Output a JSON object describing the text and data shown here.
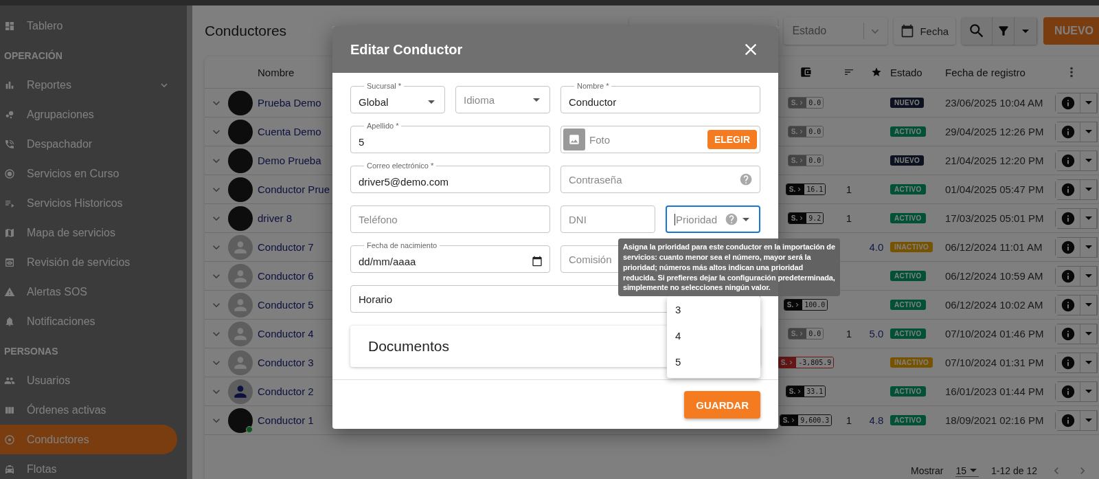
{
  "sidebar": {
    "items": [
      {
        "kind": "item",
        "label": "Tablero",
        "selected": false,
        "has_submenu": false
      },
      {
        "kind": "section",
        "label": "OPERACIÓN"
      },
      {
        "kind": "item",
        "label": "Reportes",
        "selected": false,
        "has_submenu": true
      },
      {
        "kind": "item",
        "label": "Agrupaciones",
        "selected": false,
        "has_submenu": false
      },
      {
        "kind": "item",
        "label": "Despachador",
        "selected": false,
        "has_submenu": false
      },
      {
        "kind": "item",
        "label": "Servicios en Curso",
        "selected": false,
        "has_submenu": false
      },
      {
        "kind": "item",
        "label": "Servicios Historicos",
        "selected": false,
        "has_submenu": false
      },
      {
        "kind": "item",
        "label": "Mapa de servicios",
        "selected": false,
        "has_submenu": false
      },
      {
        "kind": "item",
        "label": "Revisión de servicios",
        "selected": false,
        "has_submenu": false
      },
      {
        "kind": "item",
        "label": "Alertas SOS",
        "selected": false,
        "has_submenu": false
      },
      {
        "kind": "item",
        "label": "Notificaciones",
        "selected": false,
        "has_submenu": false
      },
      {
        "kind": "section",
        "label": "PERSONAS"
      },
      {
        "kind": "item",
        "label": "Usuarios",
        "selected": false,
        "has_submenu": false
      },
      {
        "kind": "item",
        "label": "Órdenes activas",
        "selected": false,
        "has_submenu": false
      },
      {
        "kind": "item",
        "label": "Conductores",
        "selected": true,
        "has_submenu": false
      },
      {
        "kind": "item",
        "label": "Flotas",
        "selected": false,
        "has_submenu": false
      }
    ]
  },
  "page": {
    "title": "Conductores",
    "status_filter": {
      "placeholder": "Estado"
    },
    "date_button": "Fecha",
    "new_button": "NUEVO"
  },
  "table": {
    "columns": [
      "Nombre",
      "Estado",
      "Fecha de registro"
    ],
    "rows": [
      {
        "name": "Prueba Demo",
        "avatar": {
          "kind": "photo"
        },
        "online": false,
        "wallet": {
          "kind": "zero",
          "prefix": "S.",
          "amount": "0.0"
        },
        "status": {
          "kind": "new",
          "label": "NUEVO"
        },
        "date": "23/06/2025 10:04 AM"
      },
      {
        "name": "Cuenta Demo",
        "avatar": {
          "kind": "photo"
        },
        "online": false,
        "wallet": {
          "kind": "zero",
          "prefix": "S.",
          "amount": "0.0"
        },
        "status": {
          "kind": "active",
          "label": "ACTIVO"
        },
        "date": "29/04/2025 12:26 PM"
      },
      {
        "name": "Demo Prueba",
        "avatar": {
          "kind": "photo"
        },
        "online": false,
        "wallet": {
          "kind": "zero",
          "prefix": "S.",
          "amount": "0.0"
        },
        "status": {
          "kind": "new",
          "label": "NUEVO"
        },
        "date": "21/04/2025 12:20 PM"
      },
      {
        "name": "Conductor Prue",
        "avatar": {
          "kind": "photo"
        },
        "online": false,
        "wallet": {
          "kind": "positive",
          "prefix": "S.",
          "amount": "16.1"
        },
        "count": "1",
        "status": {
          "kind": "active",
          "label": "ACTIVO"
        },
        "date": "01/04/2025 05:47 PM"
      },
      {
        "name": "driver 8",
        "avatar": {
          "kind": "photo"
        },
        "online": false,
        "wallet": {
          "kind": "positive",
          "prefix": "S.",
          "amount": "9.2"
        },
        "count": "1",
        "status": {
          "kind": "active",
          "label": "ACTIVO"
        },
        "date": "17/03/2025 05:01 PM"
      },
      {
        "name": "Conductor 7",
        "avatar": {
          "kind": "placeholder"
        },
        "online": false,
        "rating": "4.0",
        "status": {
          "kind": "inactive",
          "label": "INACTIVO"
        },
        "date": "06/12/2024 11:01 AM"
      },
      {
        "name": "Conductor 6",
        "avatar": {
          "kind": "placeholder"
        },
        "online": false,
        "status": {
          "kind": "active",
          "label": "ACTIVO"
        },
        "date": "06/12/2024 10:59 AM"
      },
      {
        "name": "Conductor 5",
        "avatar": {
          "kind": "placeholder"
        },
        "online": false,
        "wallet": {
          "kind": "positive",
          "prefix": "S.",
          "amount": "100.0"
        },
        "status": {
          "kind": "active",
          "label": "ACTIVO"
        },
        "date": "06/12/2024 10:02 AM"
      },
      {
        "name": "Conductor 4",
        "avatar": {
          "kind": "placeholder"
        },
        "online": false,
        "wallet": {
          "kind": "zero",
          "prefix": "S.",
          "amount": "0.0"
        },
        "count": "1",
        "rating": "5.0",
        "status": {
          "kind": "active",
          "label": "ACTIVO"
        },
        "date": "07/10/2024 01:46 PM"
      },
      {
        "name": "Conductor 3",
        "avatar": {
          "kind": "placeholder"
        },
        "online": false,
        "wallet": {
          "kind": "negative",
          "prefix": "S.",
          "amount": "-3,805.9"
        },
        "status": {
          "kind": "inactive",
          "label": "INACTIVO"
        },
        "date": "07/10/2024 01:31 PM"
      },
      {
        "name": "Conductor 2",
        "avatar": {
          "kind": "placeholder_user"
        },
        "online": false,
        "wallet": {
          "kind": "positive",
          "prefix": "S.",
          "amount": "33.1"
        },
        "status": {
          "kind": "active",
          "label": "ACTIVO"
        },
        "date": "16/01/2023 01:44 PM"
      },
      {
        "name": "Conductor 1",
        "avatar": {
          "kind": "photo"
        },
        "online": true,
        "wallet": {
          "kind": "positive",
          "prefix": "S.",
          "amount": "9,600.3"
        },
        "count": "1",
        "rating": "4.8",
        "status": {
          "kind": "active",
          "label": "ACTIVO"
        },
        "date": "18/09/2021 02:16 PM"
      }
    ]
  },
  "pagination": {
    "label": "Mostrar",
    "page_size": "15",
    "range": "1-12 de 12"
  },
  "modal": {
    "title": "Editar Conductor",
    "fields": [
      {
        "kind": "select",
        "label": "Sucursal *",
        "value": "Global",
        "focused": false
      },
      {
        "kind": "select",
        "placeholder": "Idioma",
        "focused": false
      },
      {
        "kind": "text",
        "label": "Nombre *",
        "value": "Conductor",
        "focused": false
      },
      {
        "kind": "text",
        "label": "Apellido *",
        "value": "5",
        "focused": false
      },
      {
        "kind": "file",
        "placeholder": "Foto",
        "button": "ELEGIR",
        "focused": false
      },
      {
        "kind": "text",
        "label": "Correo electrónico *",
        "value": "driver5@demo.com",
        "focused": false
      },
      {
        "kind": "help",
        "placeholder": "Contraseña",
        "focused": false
      },
      {
        "kind": "text",
        "placeholder": "Teléfono",
        "focused": false
      },
      {
        "kind": "text",
        "placeholder": "DNI",
        "focused": false
      },
      {
        "kind": "help_select",
        "placeholder": "Prioridad",
        "focused": true
      },
      {
        "kind": "date",
        "label": "Fecha de nacimiento",
        "value": "dd/mm/aaaa",
        "focused": false
      },
      {
        "kind": "text",
        "placeholder": "Comisión",
        "focused": false
      },
      {
        "kind": "text",
        "value": "Horario",
        "focused": false
      }
    ],
    "documents": {
      "title": "Documentos"
    },
    "save_button": "GUARDAR",
    "priority_menu": {
      "options": [
        "3",
        "4",
        "5"
      ]
    },
    "tooltip": "Asigna la prioridad para este conductor en la importación de servicios: cuanto menor sea el número, mayor será la prioridad; números más altos indican una prioridad reducida. Si prefieres dejar la configuración predeterminada, simplemente no selecciones ningún valor."
  }
}
